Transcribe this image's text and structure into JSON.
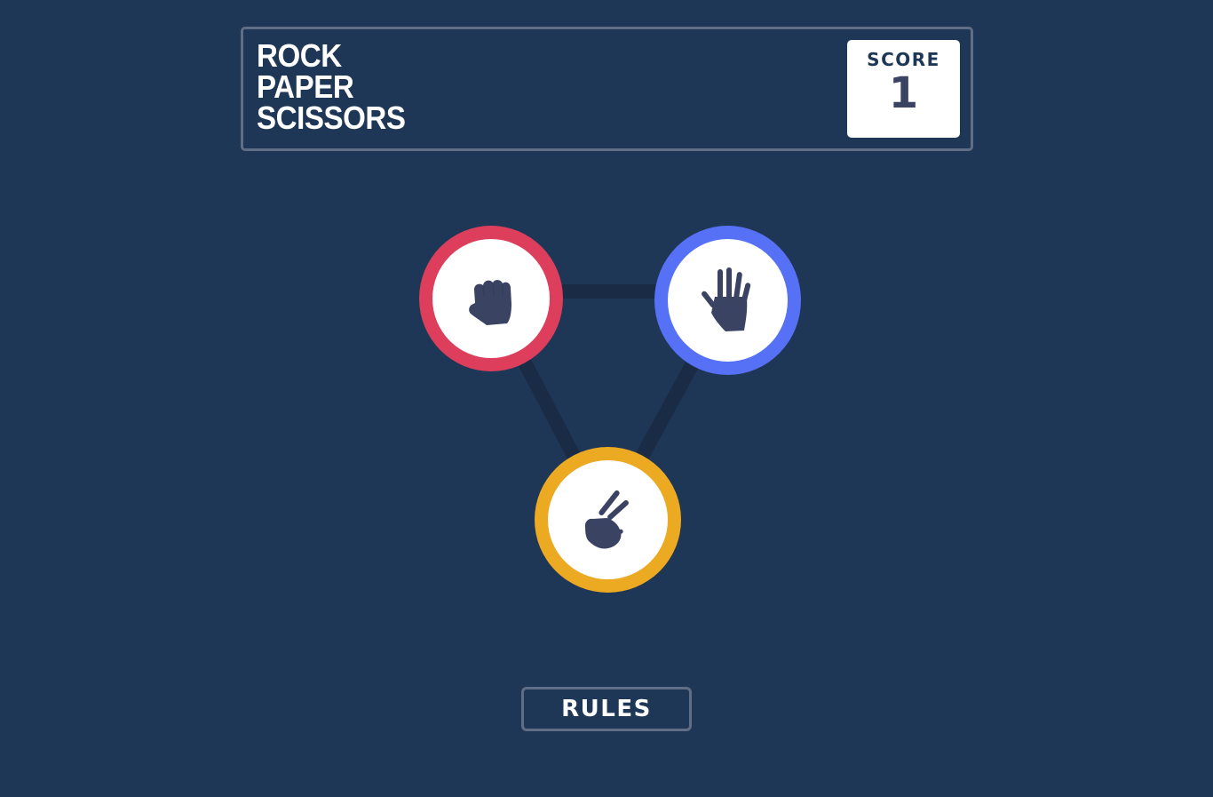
{
  "header": {
    "title_lines": [
      "ROCK",
      "PAPER",
      "SCISSORS"
    ],
    "score_label": "SCORE",
    "score_value": "1"
  },
  "choices": [
    {
      "name": "rock",
      "icon": "fist-icon",
      "ring_color": "#dc3e5b"
    },
    {
      "name": "paper",
      "icon": "open-hand-icon",
      "ring_color": "#5671f5"
    },
    {
      "name": "scissors",
      "icon": "two-finger-hand-icon",
      "ring_color": "#eca922"
    }
  ],
  "footer": {
    "rules_label": "RULES"
  },
  "colors": {
    "background": "#1f3756",
    "header_border": "#606e85",
    "icon": "#3b4363",
    "connector": "#1a2c45"
  }
}
